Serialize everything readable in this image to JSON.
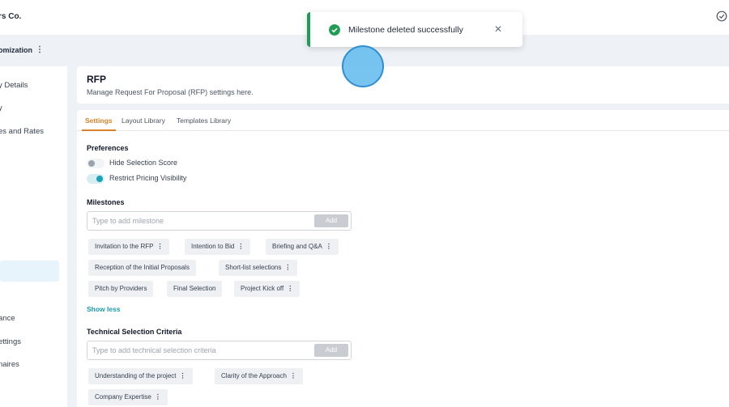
{
  "app": {
    "brand": "rs Co.",
    "section_title": "omization"
  },
  "sidebar": {
    "items": [
      {
        "label": "y Details"
      },
      {
        "label": "y"
      },
      {
        "label": "es and Rates"
      },
      {
        "label": "ance"
      },
      {
        "label": "ettings"
      },
      {
        "label": "naires"
      }
    ]
  },
  "header": {
    "title": "RFP",
    "description": "Manage Request For Proposal (RFP) settings here."
  },
  "tabs": [
    {
      "label": "Settings"
    },
    {
      "label": "Layout Library"
    },
    {
      "label": "Templates Library"
    }
  ],
  "preferences": {
    "title": "Preferences",
    "toggles": [
      {
        "label": "Hide Selection Score",
        "state": "off"
      },
      {
        "label": "Restrict Pricing Visibility",
        "state": "on"
      }
    ]
  },
  "milestones": {
    "title": "Milestones",
    "placeholder": "Type to add milestone",
    "add_label": "Add",
    "chips": [
      {
        "label": "Invitation to the RFP",
        "kebab": "⋮"
      },
      {
        "label": "Intention to Bid",
        "kebab": "⋮"
      },
      {
        "label": "Briefing and Q&A",
        "kebab": "⋮"
      },
      {
        "label": "Reception of the Initial Proposals",
        "kebab": ""
      },
      {
        "label": "Short-list selections",
        "kebab": "⋮"
      },
      {
        "label": "Pitch by Providers",
        "kebab": ""
      },
      {
        "label": "Final Selection",
        "kebab": ""
      },
      {
        "label": "Project Kick off",
        "kebab": "⋮"
      }
    ],
    "show_less": "Show less"
  },
  "criteria": {
    "title": "Technical Selection Criteria",
    "placeholder": "Type to add technical selection criteria",
    "add_label": "Add",
    "chips": [
      {
        "label": "Understanding of the project",
        "kebab": "⋮"
      },
      {
        "label": "Clarity of the Approach",
        "kebab": "⋮"
      },
      {
        "label": "Company Expertise",
        "kebab": "⋮"
      }
    ]
  },
  "toast": {
    "message": "Milestone deleted successfully",
    "close": "✕"
  },
  "colors": {
    "accent": "#d9822b",
    "teal": "#17a2b8",
    "success": "#1f9d55"
  }
}
